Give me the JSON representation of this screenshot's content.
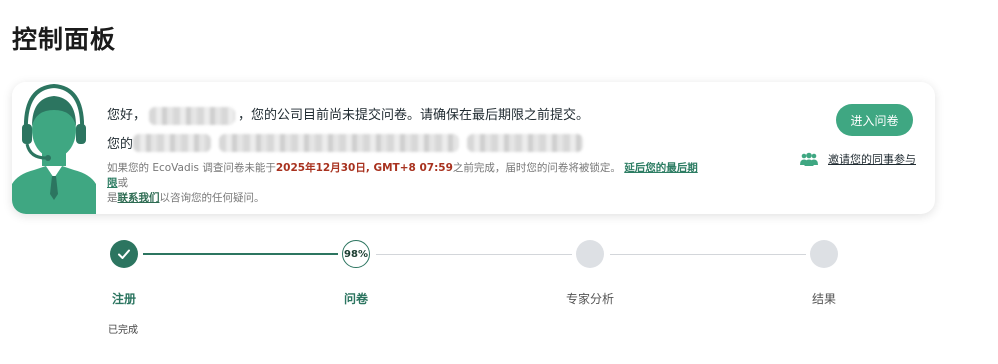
{
  "page": {
    "title": "控制面板"
  },
  "card": {
    "greeting_prefix": "您好，",
    "greeting_suffix": "，您的公司目前尚未提交问卷。请确保在最后期限之前提交。",
    "line2_prefix": "您的",
    "note": {
      "part1": "如果您的 EcoVadis 调查问卷未能于",
      "deadline": "2025年12月30日, GMT+8 07:59",
      "part2": "之前完成，届时您的问卷将被锁定。",
      "extend_link": "延后您的最后期限",
      "part3": "或",
      "part4": "是",
      "contact_link": "联系我们",
      "part5": "以咨询您的任何疑问。"
    },
    "enter_button": "进入问卷",
    "invite_label": "邀请您的同事参与"
  },
  "steps": [
    {
      "label": "注册",
      "status": "已完成",
      "state": "done"
    },
    {
      "label": "问卷",
      "progress": "98%",
      "state": "active"
    },
    {
      "label": "专家分析",
      "state": "pending"
    },
    {
      "label": "结果",
      "state": "pending"
    }
  ],
  "colors": {
    "accent": "#2c7560",
    "button": "#3fa782",
    "deadline": "#a8321f",
    "pending": "#dde0e4"
  }
}
